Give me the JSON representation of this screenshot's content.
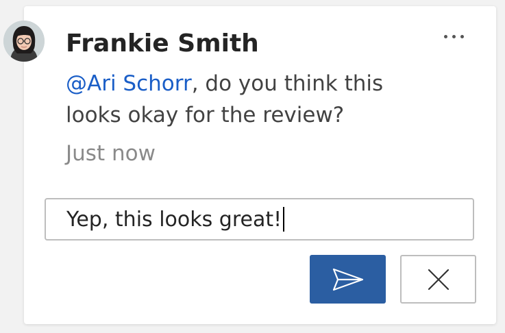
{
  "comment": {
    "author": "Frankie Smith",
    "mention": "@Ari Schorr",
    "message_rest": ", do you think this looks okay for the review?",
    "timestamp": "Just now"
  },
  "reply": {
    "value": "Yep, this looks great!"
  },
  "icons": {
    "more": "more-horizontal-icon",
    "send": "send-icon",
    "cancel": "close-icon"
  },
  "colors": {
    "accent": "#2b5ea2",
    "mention": "#1a5ec7",
    "card_background": "#ffffff",
    "page_background": "#f2f2f2"
  }
}
